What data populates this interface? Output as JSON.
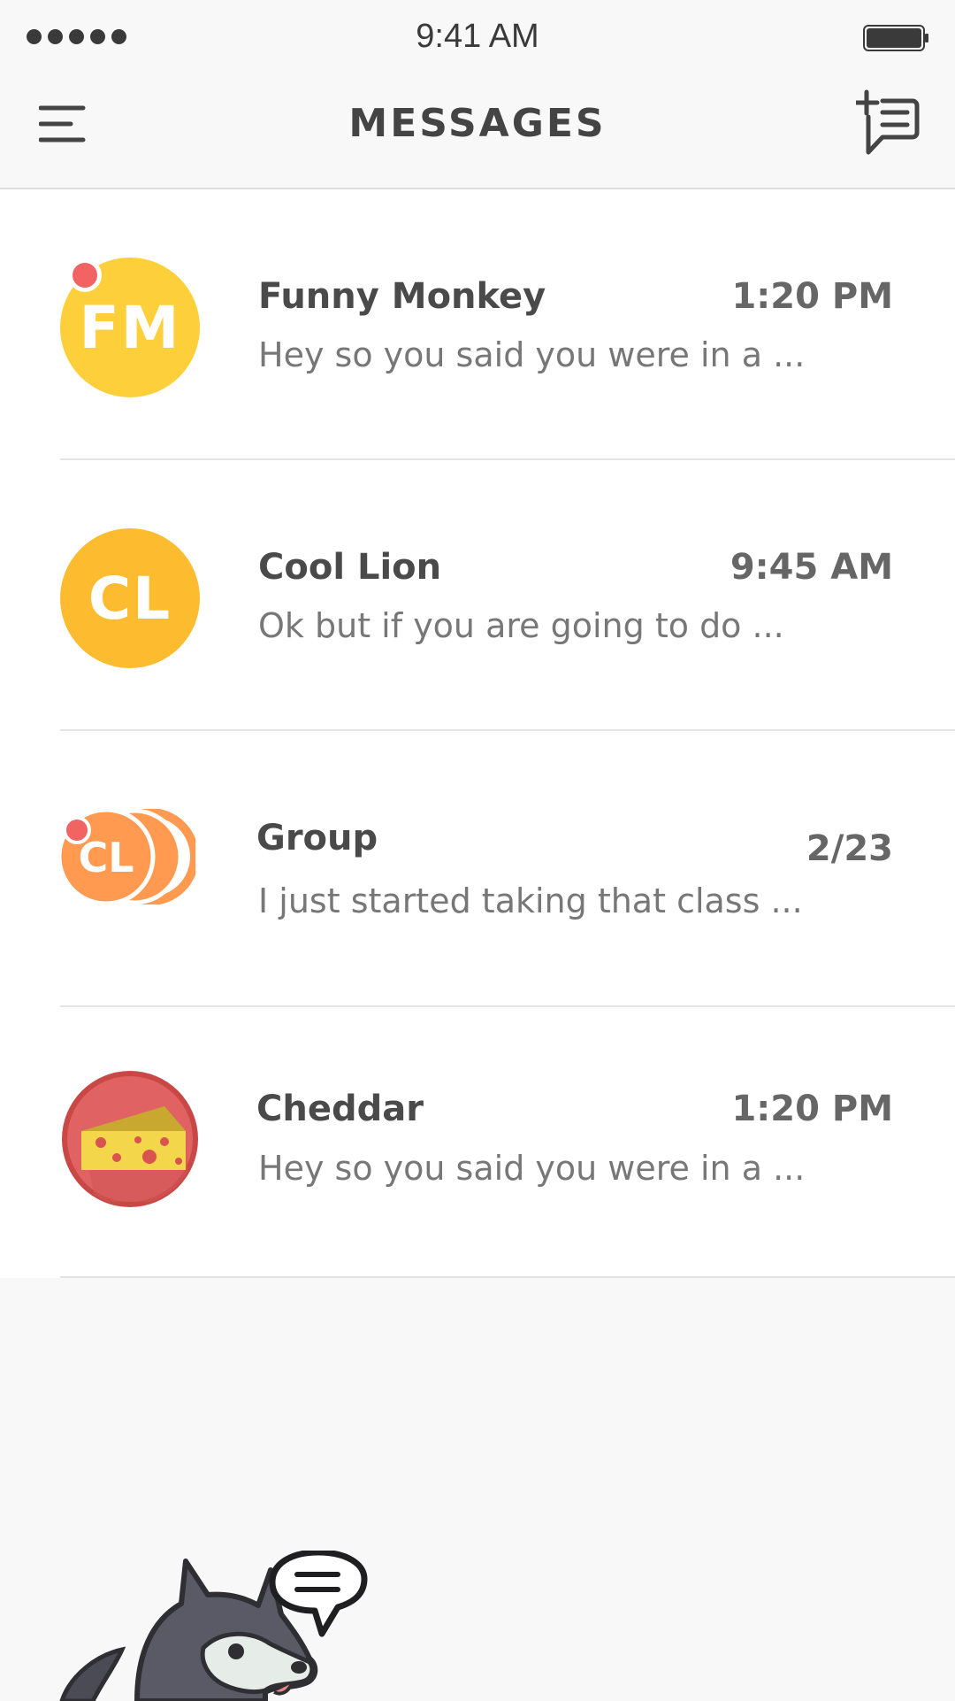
{
  "status_bar": {
    "time": "9:41 AM"
  },
  "header": {
    "title": "MESSAGES"
  },
  "colors": {
    "accent_unread": "#f26363",
    "avatar_fm": "#fdd03b",
    "avatar_cl": "#fdbb30",
    "avatar_group": "#ff9a50",
    "avatar_cheddar": "#d9534f"
  },
  "icons": {
    "menu": "hamburger-menu-icon",
    "compose": "new-message-icon",
    "mascot": "husky-mascot-icon"
  },
  "conversations": [
    {
      "name": "Funny Monkey",
      "initials": "FM",
      "time": "1:20 PM",
      "preview": "Hey so you said you were in a ...",
      "unread": true
    },
    {
      "name": "Cool Lion",
      "initials": "CL",
      "time": "9:45 AM",
      "preview": "Ok but if you are going to do ...",
      "unread": false
    },
    {
      "name": "Group",
      "initials": "CL",
      "time": "2/23",
      "preview": "I just started taking that class ...",
      "unread": true
    },
    {
      "name": "Cheddar",
      "initials": "",
      "time": "1:20 PM",
      "preview": "Hey so you said you were in a ...",
      "unread": false
    }
  ]
}
